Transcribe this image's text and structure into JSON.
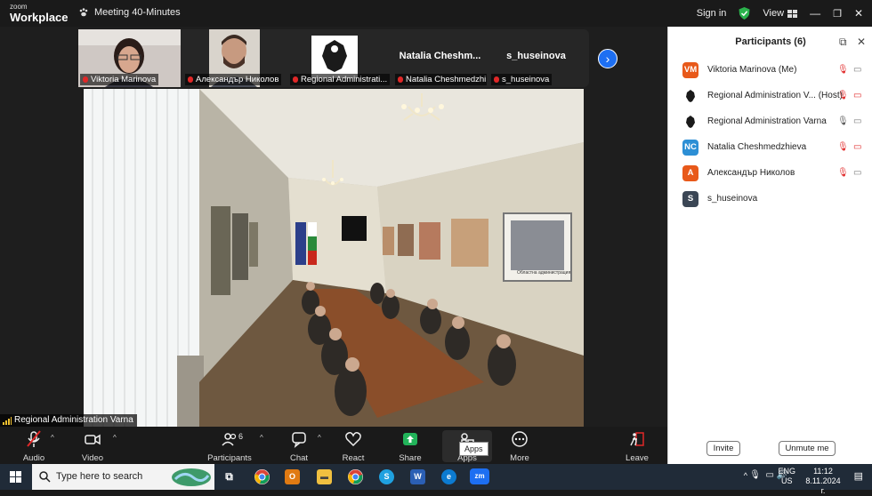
{
  "titlebar": {
    "logo_small": "zoom",
    "logo_big": "Workplace",
    "meeting_title": "Meeting 40-Minutes",
    "sign_in": "Sign in",
    "view": "View"
  },
  "strip": {
    "thumbs": [
      {
        "label": "Viktoria Marinova"
      },
      {
        "label": "Александър Николов"
      },
      {
        "label": "Regional Administrati..."
      },
      {
        "label": "Natalia Cheshmedzhi...",
        "big_name": "Natalia  Cheshm..."
      },
      {
        "label": "s_huseinova",
        "big_name": "s_huseinova"
      }
    ]
  },
  "main_video": {
    "label": "Regional Administration Varna",
    "nameplate": "Областна администрация"
  },
  "toolbar": {
    "audio": "Audio",
    "video": "Video",
    "participants": "Participants",
    "participants_count": "6",
    "chat": "Chat",
    "react": "React",
    "share": "Share",
    "apps": "Apps",
    "apps_tooltip": "Apps",
    "more": "More",
    "leave": "Leave"
  },
  "panel": {
    "title": "Participants (6)",
    "participants": [
      {
        "initials": "VM",
        "name": "Viktoria Marinova (Me)",
        "color": "#e8591a",
        "mic": "muted",
        "cam": "off"
      },
      {
        "initials": "",
        "name": "Regional Administration V... (Host)",
        "color": "#ffffff",
        "mic": "muted",
        "cam": "muted"
      },
      {
        "initials": "",
        "name": "Regional Administration Varna",
        "color": "#ffffff",
        "mic": "on",
        "cam": "off"
      },
      {
        "initials": "NC",
        "name": "Natalia Cheshmedzhieva",
        "color": "#2d8fd5",
        "mic": "muted",
        "cam": "muted"
      },
      {
        "initials": "А",
        "name": "Александър Николов",
        "color": "#e8591a",
        "mic": "muted",
        "cam": "off"
      },
      {
        "initials": "S",
        "name": "s_huseinova",
        "color": "#3b4655",
        "mic": "",
        "cam": ""
      }
    ],
    "invite": "Invite",
    "unmute_me": "Unmute me"
  },
  "taskbar": {
    "search_placeholder": "Type here to search",
    "lang": "ENG",
    "region": "US",
    "time": "11:12",
    "date": "8.11.2024 г."
  }
}
